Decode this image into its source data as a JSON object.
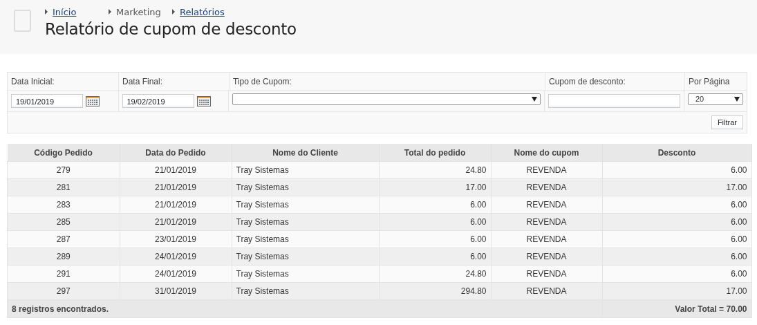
{
  "breadcrumb": [
    {
      "label": "Início",
      "link": true
    },
    {
      "label": "Marketing",
      "link": false
    },
    {
      "label": "Relatórios",
      "link": true
    }
  ],
  "title": "Relatório de cupom de desconto",
  "filters": {
    "labels": [
      "Data Inicial:",
      "Data Final:",
      "Tipo de Cupom:",
      "Cupom de desconto:",
      "Por Página"
    ],
    "date_start": "19/01/2019",
    "date_end": "19/02/2019",
    "per_page": "20",
    "button": "Filtrar"
  },
  "table": {
    "columns": [
      "Código Pedido",
      "Data do Pedido",
      "Nome do Cliente",
      "Total do pedido",
      "Nome do cupom",
      "Desconto"
    ],
    "rows": [
      [
        "279",
        "21/01/2019",
        "Tray Sistemas",
        "24.80",
        "REVENDA",
        "6.00"
      ],
      [
        "281",
        "21/01/2019",
        "Tray Sistemas",
        "17.00",
        "REVENDA",
        "17.00"
      ],
      [
        "283",
        "21/01/2019",
        "Tray Sistemas",
        "6.00",
        "REVENDA",
        "6.00"
      ],
      [
        "285",
        "21/01/2019",
        "Tray Sistemas",
        "6.00",
        "REVENDA",
        "6.00"
      ],
      [
        "287",
        "23/01/2019",
        "Tray Sistemas",
        "6.00",
        "REVENDA",
        "6.00"
      ],
      [
        "289",
        "24/01/2019",
        "Tray Sistemas",
        "6.00",
        "REVENDA",
        "6.00"
      ],
      [
        "291",
        "24/01/2019",
        "Tray Sistemas",
        "24.80",
        "REVENDA",
        "6.00"
      ],
      [
        "297",
        "31/01/2019",
        "Tray Sistemas",
        "294.80",
        "REVENDA",
        "17.00"
      ]
    ],
    "footer_count": "8 registros encontrados.",
    "footer_total": "Valor Total = 70.00"
  }
}
